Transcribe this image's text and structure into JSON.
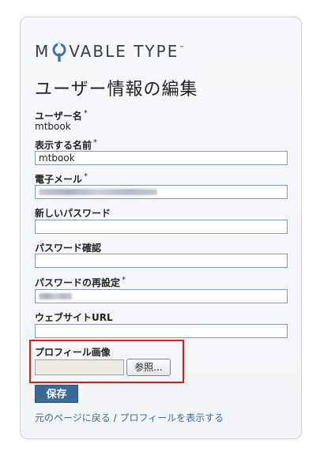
{
  "app": {
    "logo_text_before": "M",
    "logo_text_after": "VABLE TYPE",
    "logo_tm": "™",
    "page_title": "ユーザー情報の編集"
  },
  "form": {
    "username": {
      "label": "ユーザー名",
      "required_mark": "*",
      "value": "mtbook"
    },
    "display_name": {
      "label": "表示する名前",
      "required_mark": "*",
      "value": "mtbook"
    },
    "email": {
      "label": "電子メール",
      "required_mark": "*",
      "value": ""
    },
    "new_password": {
      "label": "新しいパスワード",
      "value": ""
    },
    "password_confirm": {
      "label": "パスワード確認",
      "value": ""
    },
    "password_reset": {
      "label": "パスワードの再設定",
      "required_mark": "*",
      "value": ""
    },
    "website": {
      "label": "ウェブサイトURL",
      "value": ""
    },
    "profile_image": {
      "label": "プロフィール画像",
      "browse_label": "参照..."
    }
  },
  "actions": {
    "save_label": "保存",
    "back_link": "元のページに戻る",
    "separator": "/",
    "view_profile_link": "プロフィールを表示する"
  },
  "colors": {
    "save_button": "#3c6a97",
    "highlight_border": "#e0191b",
    "link": "#3b6ea0"
  }
}
